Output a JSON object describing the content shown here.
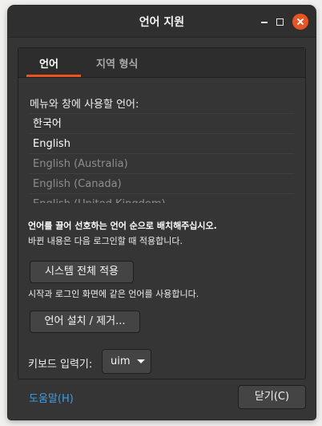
{
  "window": {
    "title": "언어 지원",
    "controls": [
      "minimize-icon",
      "maximize-icon",
      "close-icon"
    ],
    "accent_color": "#e95420"
  },
  "tabs": [
    {
      "label": "언어",
      "active": true
    },
    {
      "label": "지역 형식",
      "active": false
    }
  ],
  "language_section": {
    "label": "메뉴와 창에 사용할 언어:",
    "languages": [
      {
        "name": "한국어",
        "enabled": true
      },
      {
        "name": "English",
        "enabled": true
      },
      {
        "name": "English (Australia)",
        "enabled": false
      },
      {
        "name": "English (Canada)",
        "enabled": false
      },
      {
        "name": "English (United Kingdom)",
        "enabled": false
      }
    ],
    "hint_bold": "언어를 끌어 선호하는 언어 순으로 배치해주십시오.",
    "hint": "바뀐 내용은 다음 로그인할 때 적용합니다."
  },
  "apply_button": {
    "label": "시스템 전체 적용"
  },
  "apply_hint": "시작과 로그인 화면에 같은 언어를 사용합니다.",
  "install_button": {
    "label": "언어 설치 / 제거..."
  },
  "keyboard": {
    "label": "키보드 입력기:",
    "selected": "uim"
  },
  "footer": {
    "help_label": "도움말(H)",
    "close_label": "닫기(C)",
    "link_color": "#3c9ee5"
  }
}
